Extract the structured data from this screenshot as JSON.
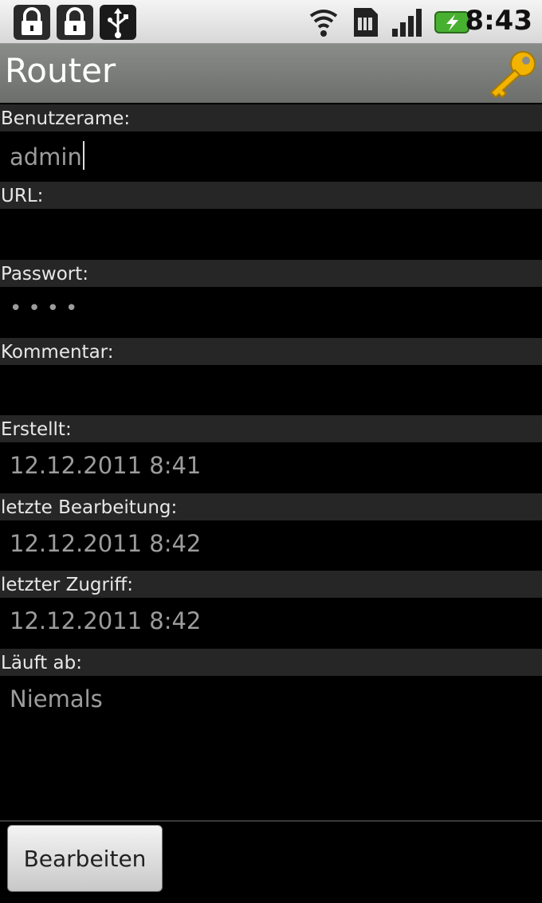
{
  "status_bar": {
    "time": "8:43",
    "icons": [
      "lock-icon",
      "lock-icon",
      "usb-icon",
      "wifi-icon",
      "sim-icon",
      "signal-icon",
      "battery-charging-icon"
    ]
  },
  "title_bar": {
    "title": "Router",
    "icon": "key-icon"
  },
  "fields": [
    {
      "label": "Benutzerame:",
      "value": "admin"
    },
    {
      "label": "URL:",
      "value": ""
    },
    {
      "label": "Passwort:",
      "value": "••••"
    },
    {
      "label": "Kommentar:",
      "value": ""
    },
    {
      "label": "Erstellt:",
      "value": "12.12.2011 8:41"
    },
    {
      "label": "letzte Bearbeitung:",
      "value": "12.12.2011 8:42"
    },
    {
      "label": "letzter Zugriff:",
      "value": "12.12.2011 8:42"
    },
    {
      "label": "Läuft ab:",
      "value": "Niemals"
    }
  ],
  "actions": {
    "edit_label": "Bearbeiten"
  },
  "colors": {
    "background": "#000000",
    "label_band": "#262626",
    "value_text": "#9c9c9c",
    "key_icon": "#f2b400"
  }
}
